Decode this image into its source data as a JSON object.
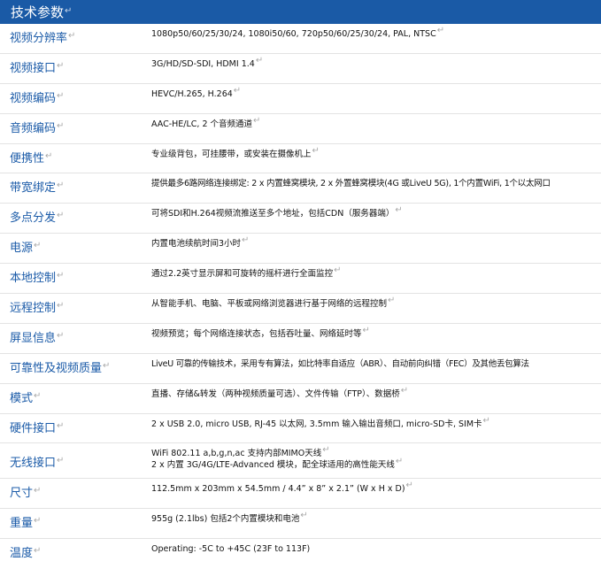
{
  "header": {
    "title": "技术参数"
  },
  "rows": [
    {
      "label": "视频分辨率",
      "value": "1080p50/60/25/30/24, 1080i50/60, 720p50/60/25/30/24, PAL, NTSC"
    },
    {
      "label": "视频接口",
      "value": "3G/HD/SD-SDI, HDMI 1.4"
    },
    {
      "label": "视频编码",
      "value": "HEVC/H.265, H.264"
    },
    {
      "label": "音频编码",
      "value": "AAC-HE/LC, 2 个音频通道"
    },
    {
      "label": "便携性",
      "value": "专业级背包，可挂腰带，或安装在摄像机上"
    },
    {
      "label": "带宽绑定",
      "value": "提供最多6路网络连接绑定: 2 x 内置蜂窝模块, 2 x 外置蜂窝模块(4G 或LiveU 5G), 1个内置WiFi, 1个以太网口"
    },
    {
      "label": "多点分发",
      "value": "可将SDI和H.264视频流推送至多个地址，包括CDN（服务器端）"
    },
    {
      "label": "电源",
      "value": "内置电池续航时间3小时"
    },
    {
      "label": "本地控制",
      "value": "通过2.2英寸显示屏和可旋转的摇杆进行全面监控"
    },
    {
      "label": "远程控制",
      "value": "从智能手机、电脑、平板或网络浏览器进行基于网络的远程控制"
    },
    {
      "label": "屏显信息",
      "value": "视频预览；每个网络连接状态，包括吞吐量、网络延时等"
    },
    {
      "label": "可靠性及视频质量",
      "value": "LiveU 可靠的传输技术，采用专有算法，如比特率自适应（ABR）、自动前向纠错（FEC）及其他丢包算法"
    },
    {
      "label": "模式",
      "value": "直播、存储&转发（两种视频质量可选）、文件传输（FTP）、数据桥"
    },
    {
      "label": "硬件接口",
      "value": "2 x USB 2.0, micro USB, RJ-45 以太网, 3.5mm 输入输出音频口, micro-SD卡, SIM卡"
    },
    {
      "label": "无线接口",
      "value_lines": [
        "WiFi 802.11 a,b,g,n,ac 支持内部MIMO天线",
        "2 x 内置 3G/4G/LTE-Advanced 模块，配全球适用的高性能天线"
      ]
    },
    {
      "label": "尺寸",
      "value": "112.5mm x 203mm x 54.5mm / 4.4” x 8” x 2.1” (W x H x D)"
    },
    {
      "label": "重量",
      "value": "955g (2.1lbs) 包括2个内置模块和电池"
    },
    {
      "label": "温度",
      "value": "Operating: -5C to +45C (23F to 113F)"
    }
  ]
}
